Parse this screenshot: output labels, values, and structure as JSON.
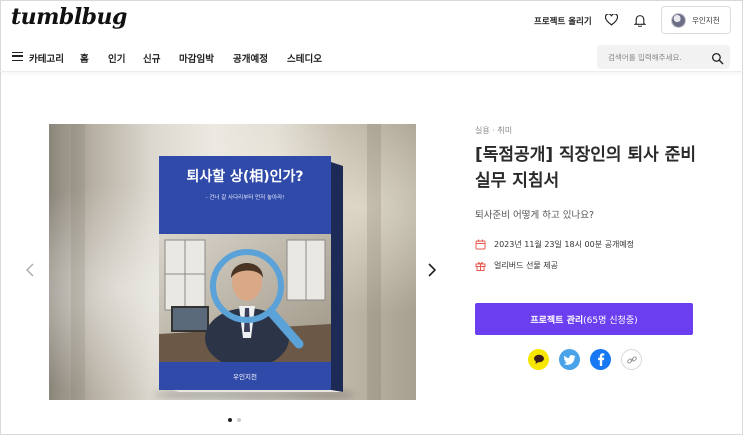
{
  "header": {
    "logo": "tumblbug",
    "create_link": "프로젝트 올리기",
    "user_name": "우인지천"
  },
  "nav": {
    "category_label": "카테고리",
    "items": [
      "홈",
      "인기",
      "신규",
      "마감임박",
      "공개예정",
      "스테디오"
    ],
    "search_placeholder": "검색어를 입력해주세요."
  },
  "book": {
    "title": "퇴사할 상(相)인가?",
    "subtitle": "- 건너 갈 사다리부터 먼저 놓아라!",
    "author": "우인지천"
  },
  "project": {
    "category": "실용 · 취미",
    "title": "[독점공개] 직장인의 퇴사 준비 실무 지침서",
    "subtitle": "퇴사준비 어떻게 하고 있나요?",
    "date": "2023년 11월 23일 18시 00분 공개예정",
    "gift": "얼리버드 선물 제공",
    "cta_label": "프로젝트 관리",
    "cta_count": "(65명 신청중)"
  },
  "slider": {
    "total": 2,
    "current": 1
  },
  "colors": {
    "accent": "#6b3ff0",
    "kakao": "#f7e600",
    "twitter": "#4aa3e8",
    "facebook": "#1877f2",
    "meta_icon": "#e85a4f"
  },
  "icons": {
    "top": [
      "heart-icon",
      "bell-icon"
    ],
    "share": [
      "kakao-icon",
      "twitter-icon",
      "facebook-icon",
      "link-icon"
    ]
  }
}
